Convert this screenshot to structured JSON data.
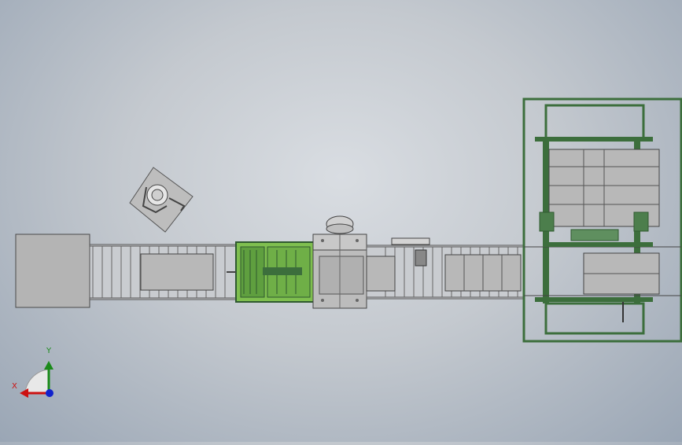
{
  "viewport": {
    "background_top": "#d9dde2",
    "background_bottom": "#9aa6b5"
  },
  "colors": {
    "machine_gray": "#b4b4b4",
    "frame_green": "#3c6e3c",
    "highlight_green": "#7fbf4f",
    "conveyor_roller": "#cfcfcf",
    "outline": "#4a4a4a"
  },
  "triad": {
    "y_label": "Y",
    "x_label": "X",
    "y_axis_color": "#1a8a1a",
    "x_axis_color": "#cc1111",
    "z_axis_color": "#1122cc",
    "y_icon": "y-axis-arrow-icon",
    "x_icon": "x-axis-arrow-icon",
    "z_icon": "z-axis-dot-icon"
  }
}
